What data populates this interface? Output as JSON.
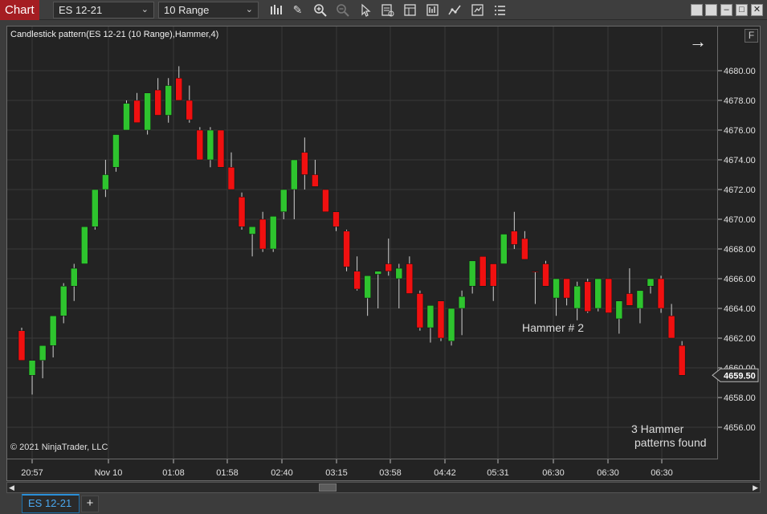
{
  "toolbar": {
    "chart_tab_label": "Chart",
    "instrument": "ES 12-21",
    "bar_type": "10 Range",
    "icons": [
      "bar-type-icon",
      "drawing-tool-icon",
      "zoom-in-icon",
      "zoom-out-icon",
      "pointer-icon",
      "data-box-icon",
      "templates-icon",
      "chart-properties-icon",
      "strategies-icon",
      "share-icon",
      "properties-menu-icon"
    ]
  },
  "chart": {
    "title": "Candlestick pattern(ES 12-21 (10 Range),Hammer,4)",
    "copyright": "© 2021 NinjaTrader, LLC",
    "f_button": "F",
    "annotation_hammer": "Hammer # 2",
    "found_line1": "3 Hammer",
    "found_line2": "patterns found",
    "last_price": "4659.50",
    "colors": {
      "up": "#2ec42e",
      "down": "#f01010",
      "wick": "#d0d0d0",
      "grid": "#3a3a3a",
      "background": "#232323"
    }
  },
  "chart_data": {
    "type": "candlestick",
    "y_ticks": [
      "4680.00",
      "4678.00",
      "4676.00",
      "4674.00",
      "4672.00",
      "4670.00",
      "4668.00",
      "4666.00",
      "4664.00",
      "4662.00",
      "4660.00",
      "4658.00",
      "4656.00"
    ],
    "ylim": [
      4654.5,
      4682.5
    ],
    "x_ticks": [
      "20:57",
      "Nov 10",
      "01:08",
      "01:58",
      "02:40",
      "03:15",
      "03:58",
      "04:42",
      "05:31",
      "06:30",
      "06:30",
      "06:30"
    ],
    "candles": [
      {
        "o": 4660.5,
        "h": 4662.7,
        "l": 4660.5,
        "c": 4662.5,
        "dir": "down"
      },
      {
        "o": 4659.5,
        "h": 4660.5,
        "l": 4658.2,
        "c": 4660.5,
        "dir": "up"
      },
      {
        "o": 4660.5,
        "h": 4661.5,
        "l": 4659.3,
        "c": 4661.5,
        "dir": "up"
      },
      {
        "o": 4661.5,
        "h": 4663.5,
        "l": 4660.7,
        "c": 4663.5,
        "dir": "up"
      },
      {
        "o": 4663.5,
        "h": 4665.7,
        "l": 4663.0,
        "c": 4665.5,
        "dir": "up"
      },
      {
        "o": 4665.5,
        "h": 4667.0,
        "l": 4664.5,
        "c": 4666.7,
        "dir": "up"
      },
      {
        "o": 4667.0,
        "h": 4669.5,
        "l": 4667.0,
        "c": 4669.5,
        "dir": "up"
      },
      {
        "o": 4669.5,
        "h": 4672.0,
        "l": 4669.3,
        "c": 4672.0,
        "dir": "up"
      },
      {
        "o": 4672.0,
        "h": 4674.0,
        "l": 4671.5,
        "c": 4673.0,
        "dir": "up"
      },
      {
        "o": 4673.5,
        "h": 4675.7,
        "l": 4673.2,
        "c": 4675.7,
        "dir": "up"
      },
      {
        "o": 4676.0,
        "h": 4678.0,
        "l": 4676.0,
        "c": 4677.8,
        "dir": "up"
      },
      {
        "o": 4678.0,
        "h": 4678.5,
        "l": 4676.5,
        "c": 4676.5,
        "dir": "down"
      },
      {
        "o": 4676.0,
        "h": 4678.5,
        "l": 4675.7,
        "c": 4678.5,
        "dir": "up"
      },
      {
        "o": 4678.7,
        "h": 4679.5,
        "l": 4677.0,
        "c": 4677.0,
        "dir": "down"
      },
      {
        "o": 4677.0,
        "h": 4679.5,
        "l": 4676.5,
        "c": 4679.0,
        "dir": "up"
      },
      {
        "o": 4679.5,
        "h": 4680.3,
        "l": 4678.0,
        "c": 4678.0,
        "dir": "down"
      },
      {
        "o": 4678.0,
        "h": 4679.0,
        "l": 4676.5,
        "c": 4676.7,
        "dir": "down"
      },
      {
        "o": 4676.0,
        "h": 4676.2,
        "l": 4674.0,
        "c": 4674.0,
        "dir": "down"
      },
      {
        "o": 4674.0,
        "h": 4676.2,
        "l": 4673.5,
        "c": 4676.0,
        "dir": "up"
      },
      {
        "o": 4676.0,
        "h": 4676.0,
        "l": 4673.5,
        "c": 4673.5,
        "dir": "down"
      },
      {
        "o": 4673.5,
        "h": 4674.5,
        "l": 4672.0,
        "c": 4672.0,
        "dir": "down"
      },
      {
        "o": 4671.5,
        "h": 4671.8,
        "l": 4669.3,
        "c": 4669.5,
        "dir": "down"
      },
      {
        "o": 4669.0,
        "h": 4669.5,
        "l": 4667.5,
        "c": 4669.5,
        "dir": "up"
      },
      {
        "o": 4670.0,
        "h": 4670.5,
        "l": 4667.8,
        "c": 4668.0,
        "dir": "down"
      },
      {
        "o": 4668.0,
        "h": 4670.2,
        "l": 4667.8,
        "c": 4670.2,
        "dir": "up"
      },
      {
        "o": 4670.5,
        "h": 4672.0,
        "l": 4670.0,
        "c": 4672.0,
        "dir": "up"
      },
      {
        "o": 4672.0,
        "h": 4674.0,
        "l": 4670.0,
        "c": 4674.0,
        "dir": "up"
      },
      {
        "o": 4674.5,
        "h": 4675.5,
        "l": 4672.0,
        "c": 4673.0,
        "dir": "down"
      },
      {
        "o": 4673.0,
        "h": 4674.0,
        "l": 4672.2,
        "c": 4672.2,
        "dir": "down"
      },
      {
        "o": 4672.0,
        "h": 4672.0,
        "l": 4670.5,
        "c": 4670.5,
        "dir": "down"
      },
      {
        "o": 4670.5,
        "h": 4670.5,
        "l": 4669.2,
        "c": 4669.5,
        "dir": "down"
      },
      {
        "o": 4669.2,
        "h": 4669.3,
        "l": 4666.5,
        "c": 4666.8,
        "dir": "down"
      },
      {
        "o": 4666.5,
        "h": 4667.5,
        "l": 4665.2,
        "c": 4665.3,
        "dir": "down"
      },
      {
        "o": 4664.7,
        "h": 4666.2,
        "l": 4663.5,
        "c": 4666.2,
        "dir": "up"
      },
      {
        "o": 4666.3,
        "h": 4666.5,
        "l": 4664.0,
        "c": 4666.5,
        "dir": "up"
      },
      {
        "o": 4667.0,
        "h": 4668.7,
        "l": 4666.2,
        "c": 4666.5,
        "dir": "down"
      },
      {
        "o": 4666.7,
        "h": 4667.0,
        "l": 4664.0,
        "c": 4666.0,
        "dir": "up"
      },
      {
        "o": 4667.0,
        "h": 4667.5,
        "l": 4665.0,
        "c": 4665.0,
        "dir": "down"
      },
      {
        "o": 4665.0,
        "h": 4665.2,
        "l": 4662.5,
        "c": 4662.7,
        "dir": "down"
      },
      {
        "o": 4662.7,
        "h": 4664.2,
        "l": 4661.7,
        "c": 4664.2,
        "dir": "up"
      },
      {
        "o": 4664.5,
        "h": 4664.5,
        "l": 4661.8,
        "c": 4662.0,
        "dir": "down"
      },
      {
        "o": 4661.8,
        "h": 4664.0,
        "l": 4661.5,
        "c": 4664.0,
        "dir": "up"
      },
      {
        "o": 4664.0,
        "h": 4665.2,
        "l": 4662.2,
        "c": 4664.8,
        "dir": "up"
      },
      {
        "o": 4665.5,
        "h": 4667.2,
        "l": 4665.0,
        "c": 4667.2,
        "dir": "up"
      },
      {
        "o": 4667.5,
        "h": 4667.5,
        "l": 4665.5,
        "c": 4665.5,
        "dir": "down"
      },
      {
        "o": 4667.0,
        "h": 4667.0,
        "l": 4664.5,
        "c": 4665.5,
        "dir": "down"
      },
      {
        "o": 4667.0,
        "h": 4669.0,
        "l": 4667.0,
        "c": 4669.0,
        "dir": "up"
      },
      {
        "o": 4669.2,
        "h": 4670.5,
        "l": 4668.0,
        "c": 4668.3,
        "dir": "down"
      },
      {
        "o": 4668.7,
        "h": 4669.2,
        "l": 4667.3,
        "c": 4667.3,
        "dir": "down"
      },
      {
        "o": 4666.5,
        "h": 4666.5,
        "l": 4664.3,
        "c": 4666.5,
        "dir": "down"
      },
      {
        "o": 4667.0,
        "h": 4667.2,
        "l": 4665.5,
        "c": 4665.5,
        "dir": "down"
      },
      {
        "o": 4664.7,
        "h": 4666.0,
        "l": 4663.5,
        "c": 4666.0,
        "dir": "up"
      },
      {
        "o": 4666.0,
        "h": 4666.0,
        "l": 4664.2,
        "c": 4664.7,
        "dir": "down"
      },
      {
        "o": 4664.0,
        "h": 4665.8,
        "l": 4663.2,
        "c": 4665.5,
        "dir": "up"
      },
      {
        "o": 4665.8,
        "h": 4666.0,
        "l": 4663.7,
        "c": 4663.8,
        "dir": "down"
      },
      {
        "o": 4664.0,
        "h": 4666.0,
        "l": 4663.8,
        "c": 4666.0,
        "dir": "up"
      },
      {
        "o": 4666.0,
        "h": 4666.0,
        "l": 4663.7,
        "c": 4663.7,
        "dir": "down"
      },
      {
        "o": 4663.3,
        "h": 4664.5,
        "l": 4662.3,
        "c": 4664.5,
        "dir": "up"
      },
      {
        "o": 4665.0,
        "h": 4666.7,
        "l": 4664.2,
        "c": 4664.2,
        "dir": "down"
      },
      {
        "o": 4664.0,
        "h": 4665.2,
        "l": 4663.0,
        "c": 4665.2,
        "dir": "up"
      },
      {
        "o": 4665.5,
        "h": 4666.0,
        "l": 4665.0,
        "c": 4666.0,
        "dir": "up"
      },
      {
        "o": 4666.0,
        "h": 4666.2,
        "l": 4663.7,
        "c": 4664.0,
        "dir": "down"
      },
      {
        "o": 4663.5,
        "h": 4664.3,
        "l": 4662.0,
        "c": 4662.0,
        "dir": "down"
      },
      {
        "o": 4661.5,
        "h": 4661.8,
        "l": 4659.5,
        "c": 4659.5,
        "dir": "down"
      }
    ]
  },
  "scrollbar": {
    "left_arrow": "◀",
    "right_arrow": "▶"
  },
  "tabs": {
    "active": "ES 12-21",
    "add": "+"
  }
}
